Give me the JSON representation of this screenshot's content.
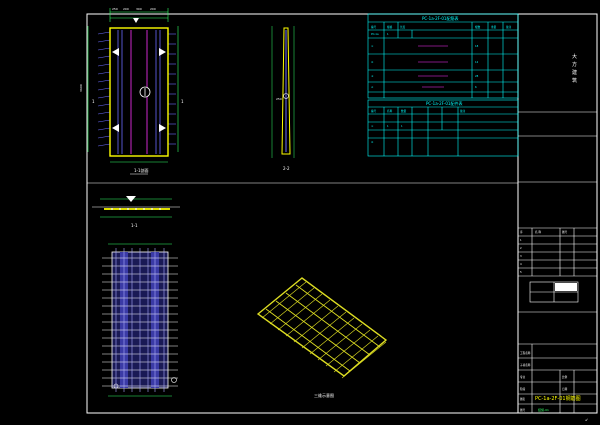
{
  "drawing": {
    "sheet_title": "PC-1a-2F-01钢筋图",
    "view_labels": {
      "plan": "1-1剖面",
      "elevation": "1-1",
      "side_section": "2-2",
      "isometric": "三维示意图"
    },
    "table_titles": [
      "PC-1a-2F-01配筋表",
      "PC-1a-2F-01配件表"
    ]
  },
  "title_block": {
    "company": "大方建筑"
  },
  "colors": {
    "background": "#000000",
    "frame": "#ffffff",
    "slab_outline": "#ffff00",
    "rebar": "#6b6bff",
    "magenta": "#ff33ff",
    "dimension": "#33ff66",
    "table": "#00ffff",
    "rebar_3d": "#dddd22"
  }
}
